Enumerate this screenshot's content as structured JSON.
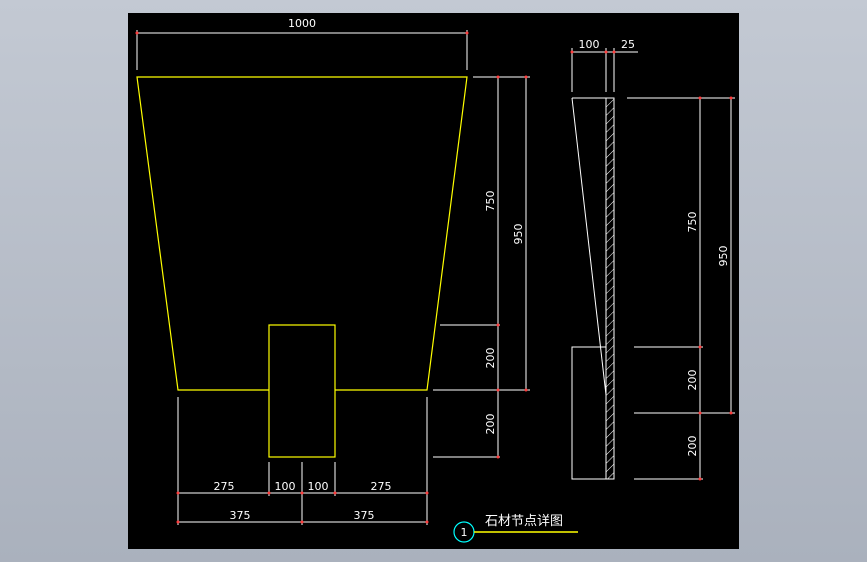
{
  "drawing": {
    "background": "#000000",
    "outline_color": "#ffff00",
    "dimension_color": "#ffffff",
    "tick_color": "#ff3b3b",
    "callout_color": "#00ffff",
    "elevation": {
      "top_width": "1000",
      "height_upper": "750",
      "height_total": "950",
      "height_mid": "200",
      "height_lower": "200",
      "bottom_left_outer": "275",
      "bottom_left_inner": "100",
      "bottom_right_inner": "100",
      "bottom_right_outer": "275",
      "half_left": "375",
      "half_right": "375"
    },
    "section": {
      "thickness_stone": "100",
      "thickness_panel": "25",
      "height_upper": "750",
      "height_total": "950",
      "height_mid": "200",
      "height_lower": "200"
    },
    "title_block": {
      "number": "1",
      "title": "石材节点详图"
    }
  }
}
